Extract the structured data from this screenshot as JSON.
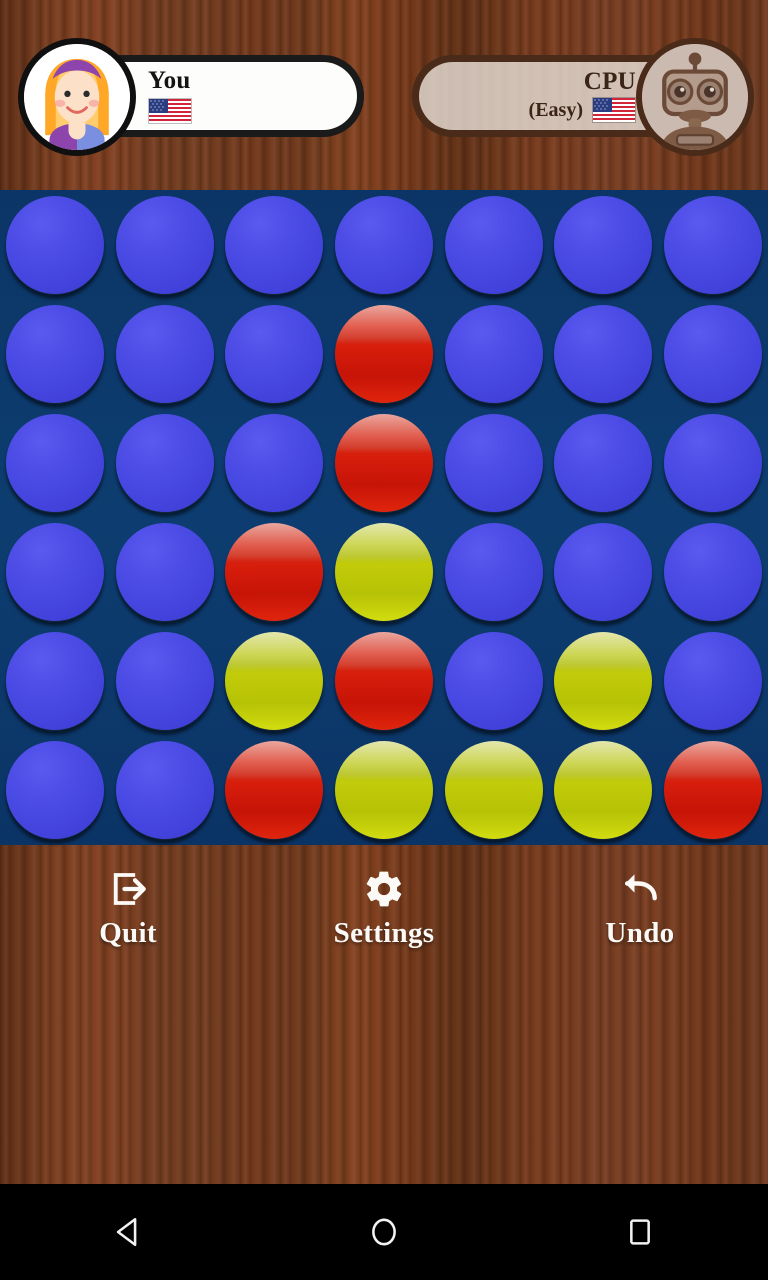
{
  "app": {
    "title": "Connect Four",
    "board_bg": "#0d3d70",
    "wood_bg": "#753a20"
  },
  "players": {
    "human": {
      "name": "You",
      "avatar": "girl-avatar-icon",
      "flag": "us-flag-icon",
      "active": true
    },
    "cpu": {
      "name": "CPU",
      "difficulty": "(Easy)",
      "avatar": "robot-avatar-icon",
      "flag": "us-flag-icon",
      "active": false
    }
  },
  "toolbar": {
    "quit_label": "Quit",
    "quit_icon": "exit-icon",
    "settings_label": "Settings",
    "settings_icon": "gear-icon",
    "undo_label": "Undo",
    "undo_icon": "undo-arrow-icon"
  },
  "navbar": {
    "back_icon": "back-triangle-icon",
    "home_icon": "home-circle-icon",
    "recents_icon": "recents-square-icon"
  },
  "board": {
    "rows": 6,
    "cols": 7,
    "colors": {
      "empty": "#4a4ae4",
      "red": "#d81e0c",
      "yellow": "#c2cc0a"
    },
    "grid": [
      [
        "empty",
        "empty",
        "empty",
        "empty",
        "empty",
        "empty",
        "empty"
      ],
      [
        "empty",
        "empty",
        "empty",
        "red",
        "empty",
        "empty",
        "empty"
      ],
      [
        "empty",
        "empty",
        "empty",
        "red",
        "empty",
        "empty",
        "empty"
      ],
      [
        "empty",
        "empty",
        "red",
        "yellow",
        "empty",
        "empty",
        "empty"
      ],
      [
        "empty",
        "empty",
        "yellow",
        "red",
        "empty",
        "yellow",
        "empty"
      ],
      [
        "empty",
        "empty",
        "red",
        "yellow",
        "yellow",
        "yellow",
        "red"
      ]
    ]
  }
}
